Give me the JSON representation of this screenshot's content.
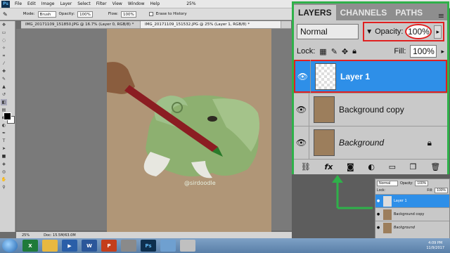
{
  "menubar": {
    "logo": "Ps",
    "items": [
      "File",
      "Edit",
      "Image",
      "Layer",
      "Select",
      "Filter",
      "View",
      "Window",
      "Help"
    ],
    "zoom": "25%"
  },
  "options": {
    "mode_label": "Mode:",
    "mode_value": "Brush",
    "opacity_label": "Opacity:",
    "opacity_value": "100%",
    "flow_label": "Flow:",
    "flow_value": "100%",
    "erase_history": "Erase to History"
  },
  "tabs": [
    {
      "label": "IMG_20171109_151850.JPG @ 16.7% (Layer 0, RGB/8) *"
    },
    {
      "label": "IMG_20171109_151532.JPG @ 25% (Layer 1, RGB/8) *"
    }
  ],
  "canvas": {
    "watermark": "@sirdoodle"
  },
  "status": {
    "zoom": "25%",
    "doc": "Doc: 15.5M/63.0M"
  },
  "layers_panel": {
    "tabs": [
      "LAYERS",
      "CHANNELS",
      "PATHS"
    ],
    "blend_mode": "Normal",
    "opacity_label": "Opacity:",
    "opacity_value": "100%",
    "lock_label": "Lock:",
    "fill_label": "Fill:",
    "fill_value": "100%",
    "layers": [
      {
        "name": "Layer 1",
        "selected": true
      },
      {
        "name": "Background copy",
        "selected": false
      },
      {
        "name": "Background",
        "selected": false,
        "locked": true
      }
    ]
  },
  "small_panel": {
    "blend_mode": "Normal",
    "opacity_label": "Opacity:",
    "opacity_value": "100%",
    "lock_label": "Lock:",
    "fill_label": "Fill:",
    "fill_value": "100%",
    "layers": [
      "Layer 1",
      "Background copy",
      "Background"
    ]
  },
  "taskbar": {
    "time": "4:09 PM",
    "date": "11/9/2017",
    "apps": [
      {
        "name": "excel",
        "glyph": "X",
        "color": "#1f7a3a"
      },
      {
        "name": "explorer",
        "glyph": "",
        "color": "#e8b840"
      },
      {
        "name": "media",
        "glyph": "▶",
        "color": "#2a5fa8"
      },
      {
        "name": "word",
        "glyph": "W",
        "color": "#2b579a"
      },
      {
        "name": "powerpoint",
        "glyph": "P",
        "color": "#c43e1c"
      },
      {
        "name": "printer",
        "glyph": "",
        "color": "#8a8a8a"
      },
      {
        "name": "photoshop",
        "glyph": "Ps",
        "color": "#0e2f4e"
      },
      {
        "name": "image-viewer",
        "glyph": "",
        "color": "#6fa0d0"
      },
      {
        "name": "paint",
        "glyph": "",
        "color": "#c0c0c0"
      }
    ]
  },
  "colors": {
    "highlight_green": "#2fb14a",
    "highlight_red": "#e02020",
    "selection_blue": "#2e8fe8"
  }
}
